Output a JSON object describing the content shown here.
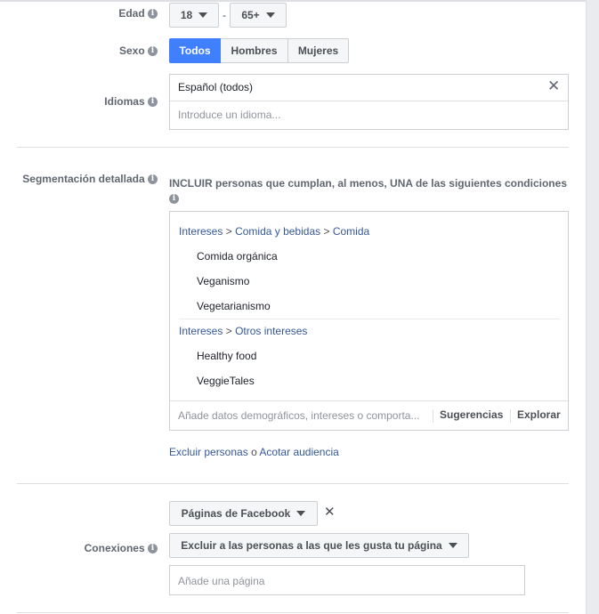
{
  "age": {
    "label": "Edad",
    "separator": "-",
    "min": "18",
    "max": "65+"
  },
  "gender": {
    "label": "Sexo",
    "options": [
      "Todos",
      "Hombres",
      "Mujeres"
    ],
    "selected": "Todos"
  },
  "languages": {
    "label": "Idiomas",
    "selected": "Español (todos)",
    "placeholder": "Introduce un idioma..."
  },
  "detailed_targeting": {
    "label": "Segmentación detallada",
    "description": "INCLUIR personas que cumplan, al menos, UNA de las siguientes condiciones",
    "groups": [
      {
        "path": [
          "Intereses",
          "Comida y bebidas",
          "Comida"
        ],
        "items": [
          "Comida orgánica",
          "Veganismo",
          "Vegetarianismo"
        ]
      },
      {
        "path": [
          "Intereses",
          "Otros intereses"
        ],
        "items": [
          "Healthy food",
          "VeggieTales"
        ]
      }
    ],
    "path_separator": ">",
    "search_placeholder": "Añade datos demográficos, intereses o comporta...",
    "suggestions": "Sugerencias",
    "browse": "Explorar",
    "exclude_link": "Excluir personas",
    "or_text": "o",
    "narrow_link": "Acotar audiencia"
  },
  "connections": {
    "label": "Conexiones",
    "type_dropdown": "Páginas de Facebook",
    "rule_dropdown": "Excluir a las personas a las que les gusta tu página",
    "page_placeholder": "Añade una página"
  },
  "icons": {
    "info": "info-icon",
    "close": "close-icon",
    "caret": "caret-down-icon"
  },
  "colors": {
    "accent": "#4080ff",
    "link": "#365899",
    "border": "#ccd0d5"
  }
}
